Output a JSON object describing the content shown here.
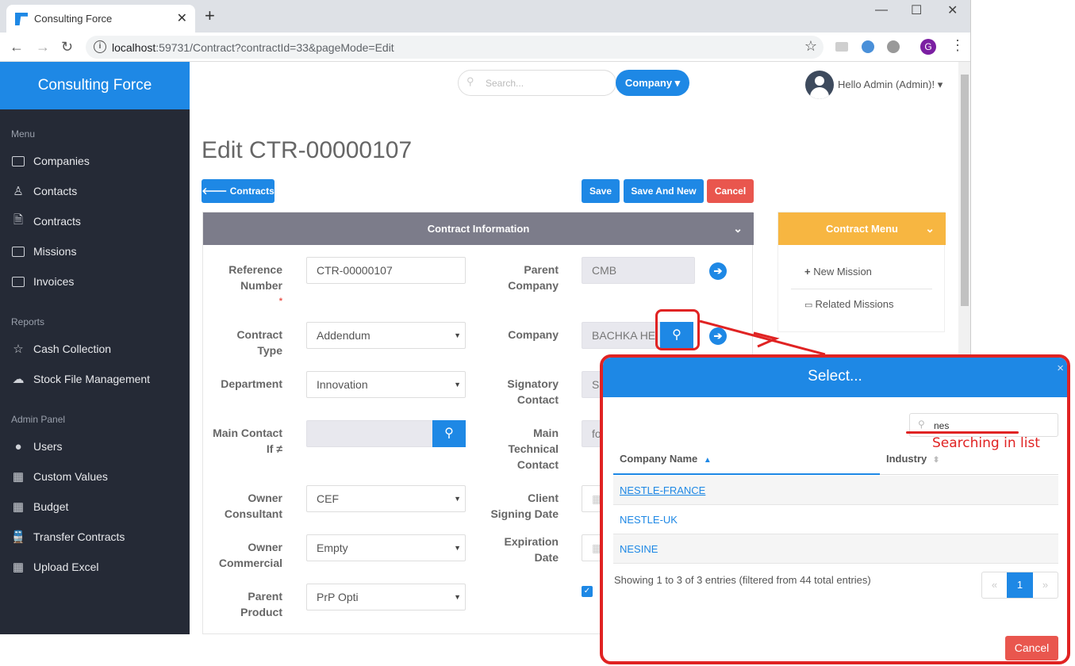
{
  "browser": {
    "tab_title": "Consulting Force",
    "tab_close": "✕",
    "new_tab": "+",
    "url_host": "localhost",
    "url_rest": ":59731/Contract?contractId=33&pageMode=Edit",
    "profile_letter": "G"
  },
  "sidebar": {
    "brand": "Consulting Force",
    "menu_title": "Menu",
    "menu_items": [
      "Companies",
      "Contacts",
      "Contracts",
      "Missions",
      "Invoices"
    ],
    "reports_title": "Reports",
    "report_items": [
      "Cash Collection",
      "Stock File Management"
    ],
    "admin_title": "Admin Panel",
    "admin_items": [
      "Users",
      "Custom Values",
      "Budget",
      "Transfer Contracts",
      "Upload Excel"
    ]
  },
  "header": {
    "search_placeholder": "Search...",
    "company_button": "Company ▾",
    "greeting": "Hello Admin (Admin)! ▾"
  },
  "page": {
    "title": "Edit CTR-00000107",
    "back_button": "Contracts",
    "save": "Save",
    "save_and_new": "Save And New",
    "cancel": "Cancel"
  },
  "contract_info": {
    "heading": "Contract Information",
    "reference_label_1": "Reference",
    "reference_label_2": "Number",
    "reference_required": "*",
    "reference_value": "CTR-00000107",
    "contract_type_label_1": "Contract",
    "contract_type_label_2": "Type",
    "contract_type_value": "Addendum",
    "department_label": "Department",
    "department_value": "Innovation",
    "main_contact_label_1": "Main Contact",
    "main_contact_label_2": "If ≠",
    "owner_consultant_label_1": "Owner",
    "owner_consultant_label_2": "Consultant",
    "owner_consultant_value": "CEF",
    "owner_commercial_label_1": "Owner",
    "owner_commercial_label_2": "Commercial",
    "owner_commercial_value": "Empty",
    "parent_product_label_1": "Parent",
    "parent_product_label_2": "Product",
    "parent_product_value": "PrP Opti",
    "parent_company_label_1": "Parent",
    "parent_company_label_2": "Company",
    "parent_company_value": "CMB",
    "company_label": "Company",
    "company_value": "BACHKA HE",
    "signatory_label_1": "Signatory",
    "signatory_label_2": "Contact",
    "signatory_value": "S",
    "main_tech_label_1": "Main",
    "main_tech_label_2": "Technical",
    "main_tech_label_3": "Contact",
    "main_tech_value": "fo",
    "client_signing_label_1": "Client",
    "client_signing_label_2": "Signing Date",
    "expiration_label_1": "Expiration",
    "expiration_label_2": "Date"
  },
  "contract_menu": {
    "heading": "Contract Menu",
    "new_mission": "New Mission",
    "related_missions": "Related Missions"
  },
  "modal": {
    "title": "Select...",
    "close": "×",
    "search_value": "nes",
    "annotation": "Searching in list",
    "columns": [
      "Company Name",
      "Industry"
    ],
    "rows": [
      "NESTLE-FRANCE",
      "NESTLE-UK",
      "NESINE"
    ],
    "info": "Showing 1 to 3 of 3 entries (filtered from 44 total entries)",
    "pager_prev": "«",
    "pager_page": "1",
    "pager_next": "»",
    "cancel": "Cancel"
  },
  "colors": {
    "primary": "#1e88e5",
    "danger": "#e9564e",
    "warning": "#f7b641",
    "sidebar": "#252a36",
    "annotation": "#e02323"
  }
}
